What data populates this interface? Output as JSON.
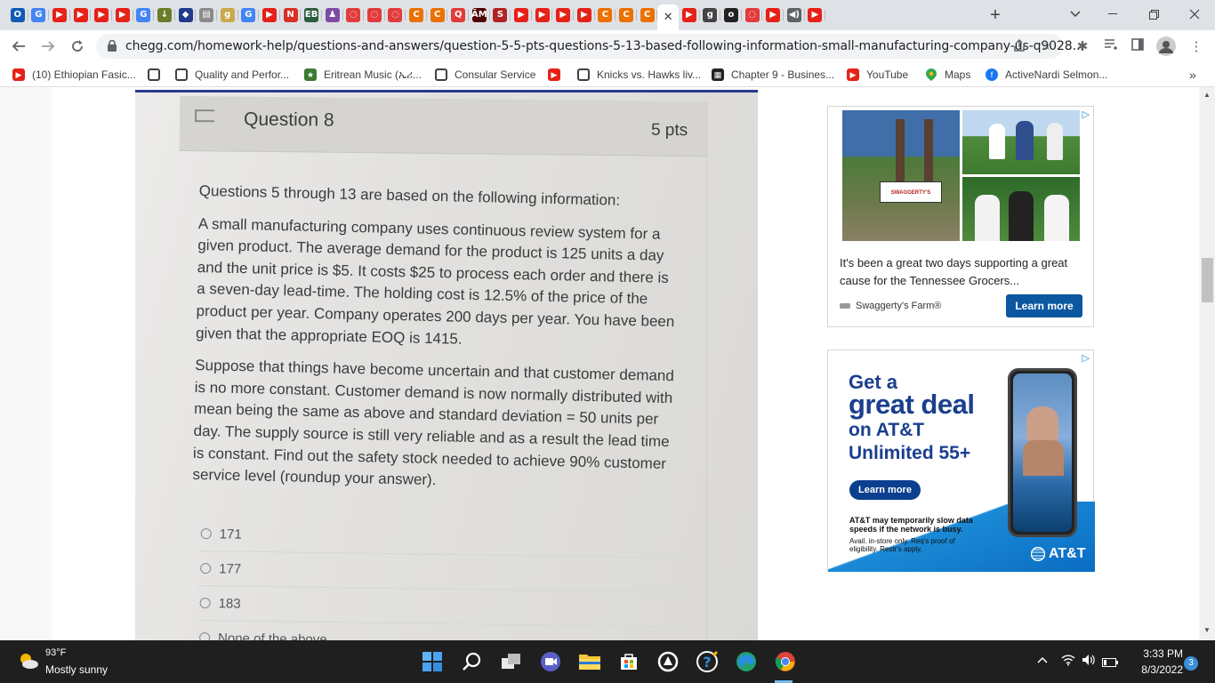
{
  "browser": {
    "tabs": [
      {
        "icon": "outlook-icon",
        "letter": "O",
        "color": "#0f5bb5"
      },
      {
        "icon": "google-icon",
        "letter": "G",
        "color": "#4285f4"
      },
      {
        "icon": "youtube-icon",
        "letter": "▶",
        "color": "#e62117"
      },
      {
        "icon": "youtube-icon",
        "letter": "▶",
        "color": "#e62117"
      },
      {
        "icon": "youtube-icon",
        "letter": "▶",
        "color": "#e62117"
      },
      {
        "icon": "youtube-icon",
        "letter": "▶",
        "color": "#e62117"
      },
      {
        "icon": "google-icon",
        "letter": "G",
        "color": "#4285f4"
      },
      {
        "icon": "download-icon",
        "letter": "↓",
        "color": "#6b7c2b"
      },
      {
        "icon": "shield-icon",
        "letter": "◆",
        "color": "#1f3b8a"
      },
      {
        "icon": "doc-icon",
        "letter": "▤",
        "color": "#8a8a8a"
      },
      {
        "icon": "grammar-icon",
        "letter": "g",
        "color": "#c9a94b"
      },
      {
        "icon": "google-icon",
        "letter": "G",
        "color": "#4285f4"
      },
      {
        "icon": "youtube-icon",
        "letter": "▶",
        "color": "#e62117"
      },
      {
        "icon": "n-icon",
        "letter": "N",
        "color": "#d93025"
      },
      {
        "icon": "eb-icon",
        "letter": "EB",
        "color": "#2d5d3b"
      },
      {
        "icon": "figure-icon",
        "letter": "♟",
        "color": "#7d4ba6"
      },
      {
        "icon": "loading-icon",
        "letter": "◌",
        "color": "#e23b3b"
      },
      {
        "icon": "loading-icon",
        "letter": "◌",
        "color": "#e23b3b"
      },
      {
        "icon": "loading-icon",
        "letter": "◌",
        "color": "#e23b3b"
      },
      {
        "icon": "chegg-icon",
        "letter": "C",
        "color": "#eb7100"
      },
      {
        "icon": "chegg-icon",
        "letter": "C",
        "color": "#eb7100"
      },
      {
        "icon": "search-icon",
        "letter": "Q",
        "color": "#e23b3b"
      },
      {
        "icon": "tamu-icon",
        "letter": "ĀM",
        "color": "#500000"
      },
      {
        "icon": "s-icon",
        "letter": "S",
        "color": "#b22222"
      },
      {
        "icon": "youtube-icon",
        "letter": "▶",
        "color": "#e62117"
      },
      {
        "icon": "youtube-icon",
        "letter": "▶",
        "color": "#e62117"
      },
      {
        "icon": "youtube-icon",
        "letter": "▶",
        "color": "#e62117"
      },
      {
        "icon": "youtube-icon",
        "letter": "▶",
        "color": "#e62117"
      },
      {
        "icon": "chegg-icon",
        "letter": "C",
        "color": "#eb7100"
      },
      {
        "icon": "chegg-icon",
        "letter": "C",
        "color": "#eb7100"
      },
      {
        "icon": "chegg-icon",
        "letter": "C",
        "color": "#eb7100"
      },
      {
        "icon": "close-icon",
        "letter": "✕",
        "color": "#ffffff",
        "active": true
      },
      {
        "icon": "youtube-icon",
        "letter": "▶",
        "color": "#e62117"
      },
      {
        "icon": "g-icon",
        "letter": "g",
        "color": "#444444"
      },
      {
        "icon": "o-icon",
        "letter": "o",
        "color": "#222222"
      },
      {
        "icon": "loading-icon",
        "letter": "◌",
        "color": "#e23b3b"
      },
      {
        "icon": "youtube-icon",
        "letter": "▶",
        "color": "#e62117"
      },
      {
        "icon": "audio-icon",
        "letter": "◀)",
        "color": "#5f6368"
      },
      {
        "icon": "youtube-icon",
        "letter": "▶",
        "color": "#e62117"
      }
    ],
    "url": "chegg.com/homework-help/questions-and-answers/question-5-5-pts-questions-5-13-based-following-information-small-manufacturing-company-us-q9028...",
    "bookmarks": [
      {
        "label": "(10) Ethiopian Fasic...",
        "icon": "youtube-icon"
      },
      {
        "label": "",
        "icon": "globe-icon"
      },
      {
        "label": "Quality and Perfor...",
        "icon": "globe-icon"
      },
      {
        "label": "Eritrean Music (ኤሪ...",
        "icon": "eritrea-icon"
      },
      {
        "label": "Consular Service",
        "icon": "globe-icon"
      },
      {
        "label": "",
        "icon": "youtube-icon"
      },
      {
        "label": "Knicks vs. Hawks liv...",
        "icon": "globe-icon"
      },
      {
        "label": "Chapter 9 - Busines...",
        "icon": "book-icon"
      },
      {
        "label": "YouTube",
        "icon": "youtube-icon"
      },
      {
        "label": "Maps",
        "icon": "maps-icon"
      },
      {
        "label": "ActiveNardi Selmon...",
        "icon": "facebook-icon"
      }
    ],
    "more_bookmarks": "»"
  },
  "question": {
    "title": "Question 8",
    "points": "5 pts",
    "paragraph1": "Questions 5 through 13 are based on the following information:",
    "paragraph2": "A small manufacturing company uses continuous review system for a given product. The average demand for the product is 125 units a day and the unit price is $5. It costs $25 to process each order and there is a seven-day lead-time. The holding cost is 12.5% of the price of the product per year. Company operates 200 days per year. You have been given that the appropriate EOQ is 1415.",
    "paragraph3": "Suppose that things have become uncertain and that customer demand is no more constant. Customer demand is now normally distributed with mean being the same as above and standard deviation = 50 units per day. The supply source is still very reliable and as a result the lead time is constant. Find out the safety stock needed to achieve 90% customer service level (roundup your answer).",
    "answers": [
      "171",
      "177",
      "183",
      "None of the above"
    ]
  },
  "ad1": {
    "sign_text": "SWAGGERTY'S",
    "caption": "It's been a great two days supporting a great cause for the Tennessee Grocers...",
    "brand": "Swaggerty's Farm®",
    "cta": "Learn more"
  },
  "ad2": {
    "line1": "Get a",
    "line2": "great deal",
    "line3": "on AT&T",
    "line4": "Unlimited 55+",
    "cta": "Learn more",
    "fine1": "AT&T may temporarily slow data speeds if the network is busy.",
    "fine2": "Avail. in-store only. Req's proof of eligibility. Restr's apply.",
    "logo": "AT&T"
  },
  "taskbar": {
    "temp": "93°F",
    "weather": "Mostly sunny",
    "time": "3:33 PM",
    "date": "8/3/2022",
    "notifications": "3"
  }
}
